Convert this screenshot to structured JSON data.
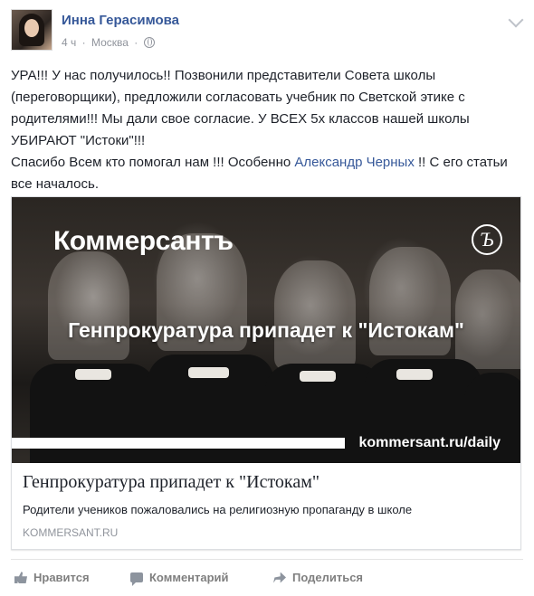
{
  "post": {
    "author": "Инна Герасимова",
    "time": "4 ч",
    "location": "Москва",
    "separator": "·",
    "text_line1": "УРА!!! У нас получилось!! Позвонили представители Совета школы (переговорщики), предложили согласовать учебник по Светской этике с родителями!!! Мы дали свое согласие. У ВСЕХ 5х классов нашей школы УБИРАЮТ \"Истоки\"!!!",
    "text_line2_start": "Спасибо Всем кто помогал нам !!! Особенно ",
    "mention": "Александр Черных",
    "text_line2_end": " !! С его статьи все началось."
  },
  "card": {
    "image_brand": "Коммерсантъ",
    "image_logo": "Ъ",
    "image_headline": "Генпрокуратура припадет к \"Истокам\"",
    "image_site": "kommersant.ru/daily",
    "title": "Генпрокуратура припадет к \"Истокам\"",
    "description": "Родители учеников пожаловались на религиозную пропаганду в школе",
    "domain": "KOMMERSANT.RU"
  },
  "actions": {
    "like": "Нравится",
    "comment": "Комментарий",
    "share": "Поделиться"
  },
  "colors": {
    "link": "#365899",
    "meta": "#90949c",
    "text": "#1d2129"
  }
}
